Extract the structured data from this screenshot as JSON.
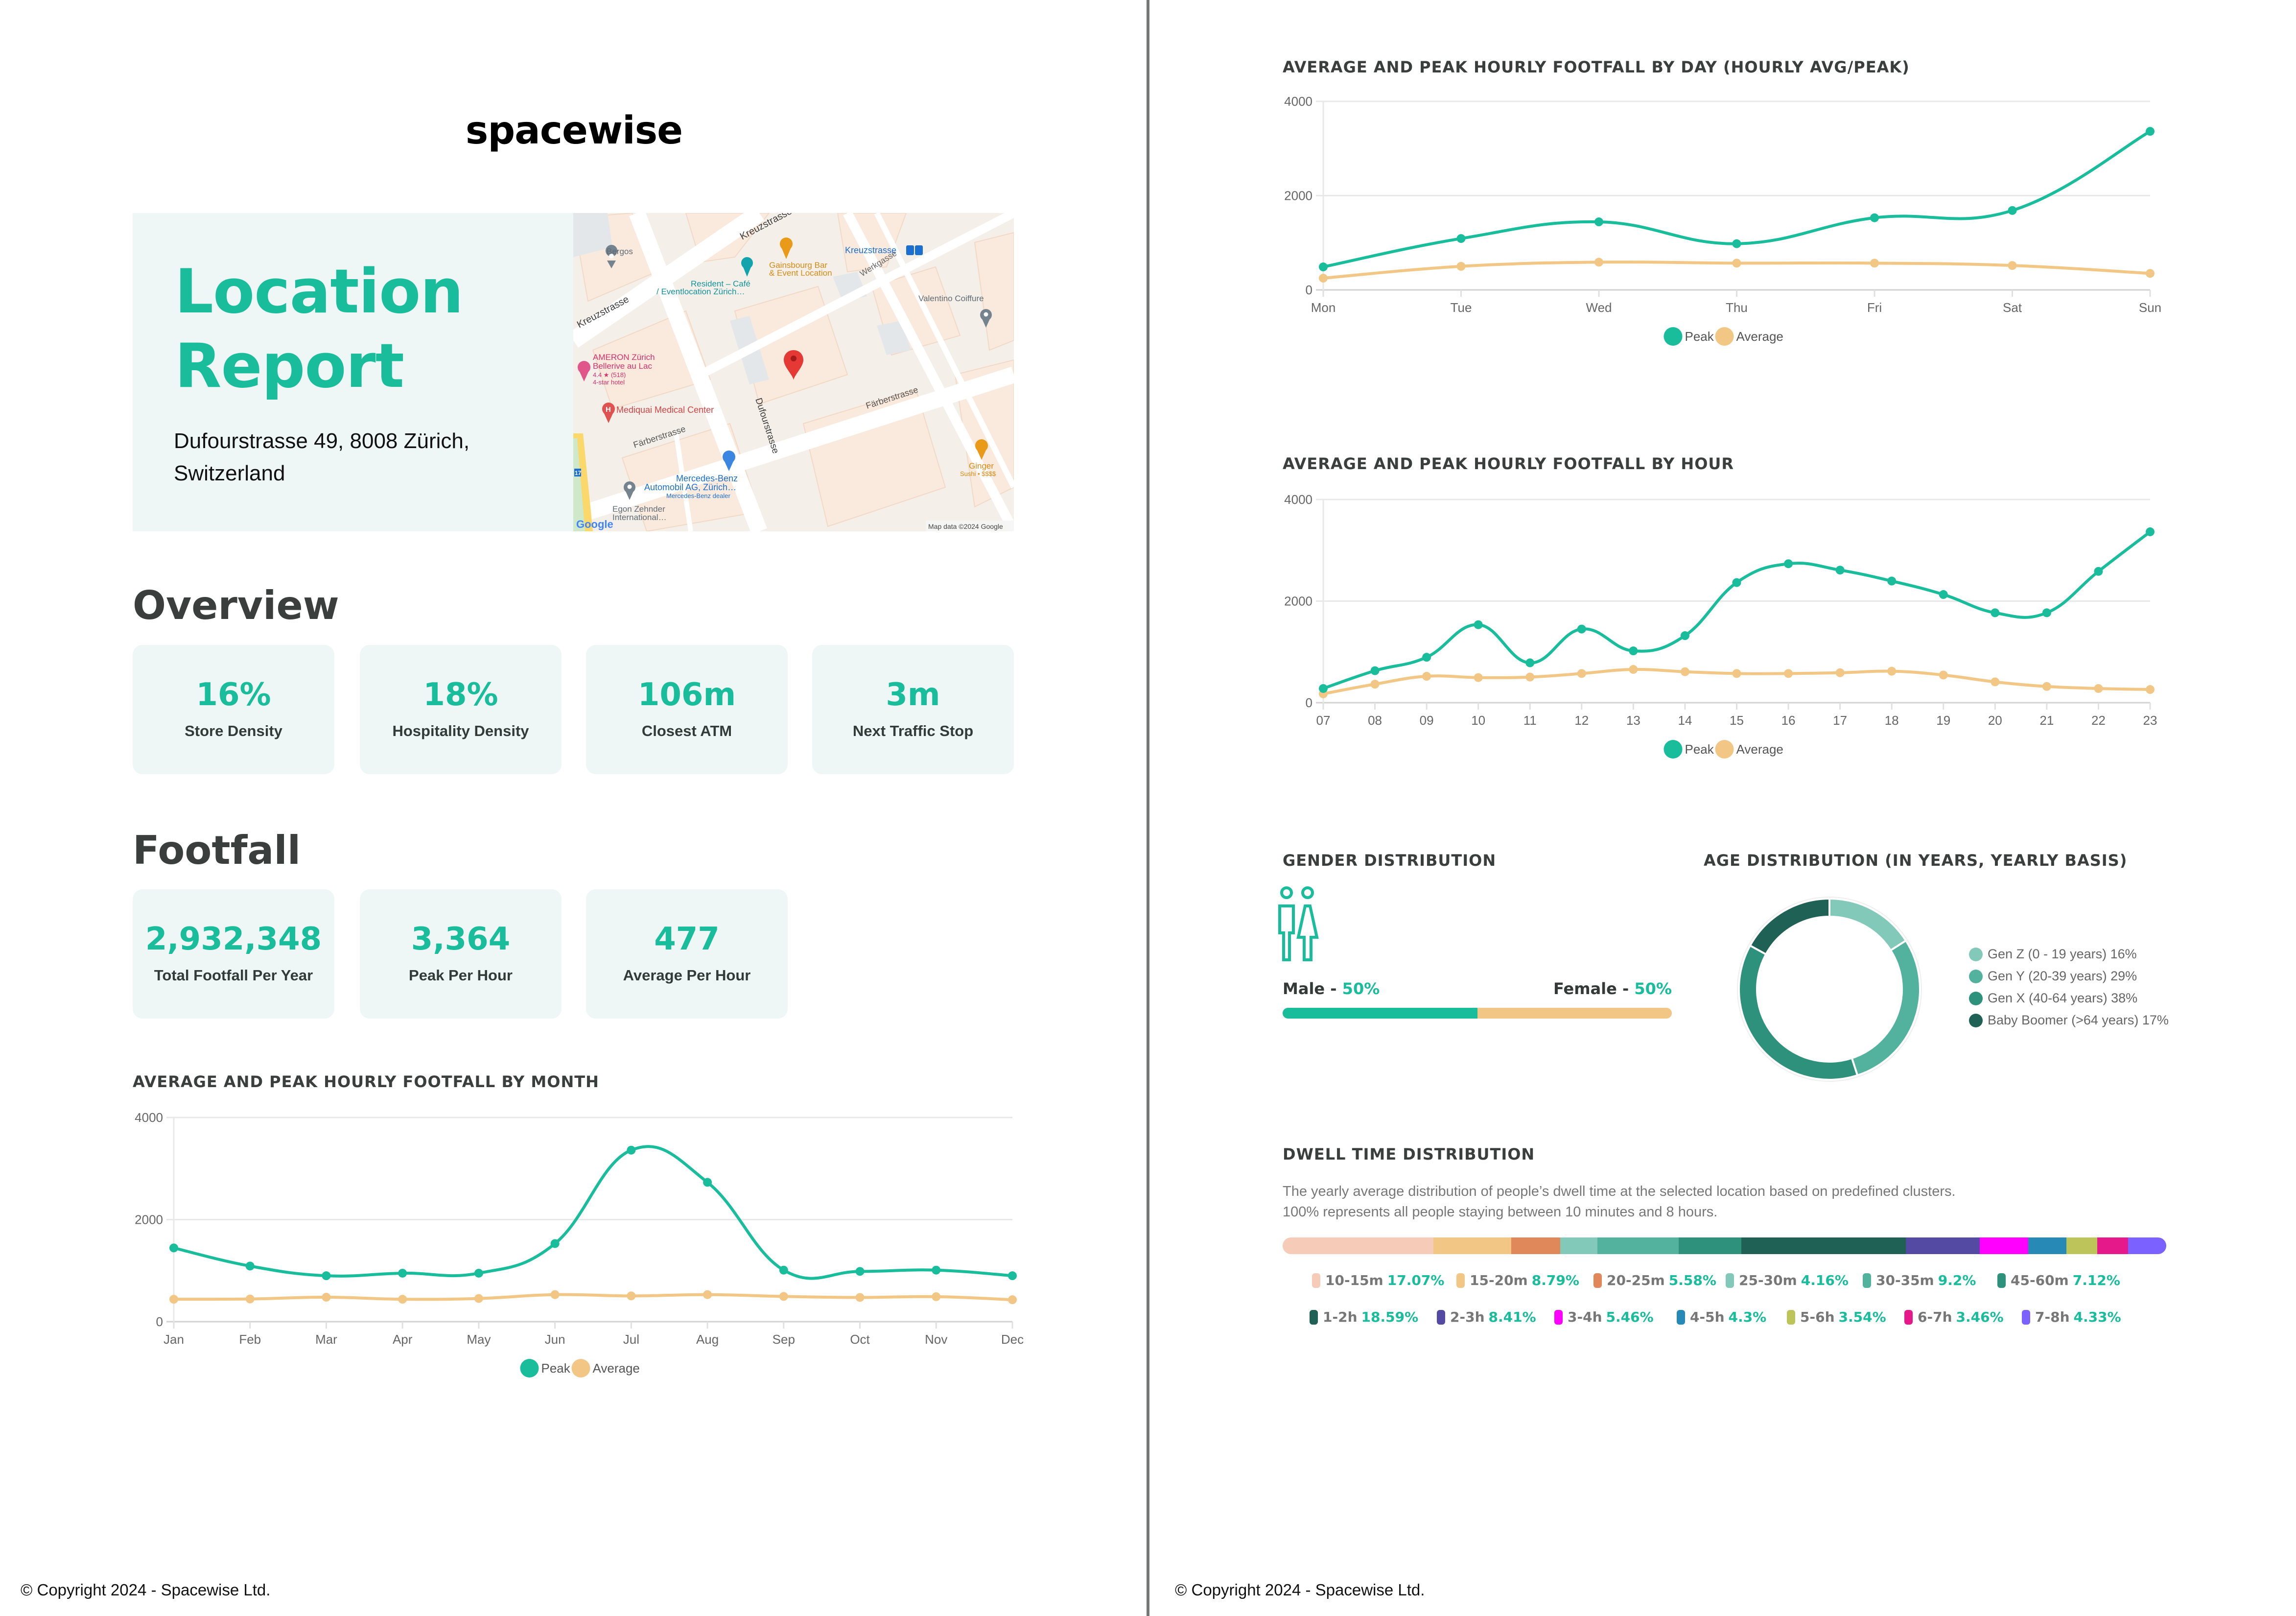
{
  "colors": {
    "accent": "#19bc9b",
    "average": "#f2c785",
    "card_bg": "#eef7f5",
    "grid": "#e6e6e6",
    "axis": "#cfcfcf",
    "divider": "#767878"
  },
  "brand": {
    "logo": "spacewise"
  },
  "hero": {
    "title_line1": "Location",
    "title_line2": "Report",
    "address_line1": "Dufourstrasse 49, 8008 Zürich,",
    "address_line2": "Switzerland"
  },
  "map": {
    "pin_icon": "location-pin-icon",
    "streets": [
      "Kreuzstrasse",
      "Kreuzstrasse",
      "Werkgasse",
      "Dufourstrasse",
      "Färberstrasse",
      "Färberstrasse"
    ],
    "places": [
      {
        "name": "Bergos",
        "color": "#5f6b75"
      },
      {
        "name": "Resident – Café",
        "sub": "/ Eventlocation Zürich…",
        "color": "#12939b"
      },
      {
        "name": "Gainsbourg Bar",
        "sub": "& Event Location",
        "color": "#d98a12"
      },
      {
        "name": "Kreuzstrasse",
        "color": "#1a6fd1"
      },
      {
        "name": "Valentino Coiffure",
        "color": "#5f6b75"
      },
      {
        "name": "AMERON Zürich",
        "sub": "Bellerive au Lac",
        "rating": "4.4 ★ (518)",
        "type": "4-star hotel",
        "color": "#d6306d"
      },
      {
        "name": "Mediquai Medical Center",
        "color": "#d84343"
      },
      {
        "name": "Mercedes-Benz",
        "sub": "Automobil AG, Zürich…",
        "type": "Mercedes-Benz dealer",
        "color": "#1a6fd1"
      },
      {
        "name": "Egon Zehnder",
        "sub": "International…",
        "color": "#5f6b75"
      },
      {
        "name": "Ginger",
        "type": "Sushi • $$$$",
        "color": "#d98a12"
      }
    ],
    "route_badge": "17",
    "google_logo": "Google",
    "attribution": "Map data ©2024 Google"
  },
  "overview": {
    "heading": "Overview",
    "cards": [
      {
        "value": "16%",
        "label": "Store Density"
      },
      {
        "value": "18%",
        "label": "Hospitality Density"
      },
      {
        "value": "106m",
        "label": "Closest ATM"
      },
      {
        "value": "3m",
        "label": "Next Traffic Stop"
      }
    ]
  },
  "footfall": {
    "heading": "Footfall",
    "cards": [
      {
        "value": "2,932,348",
        "label": "Total Footfall Per Year"
      },
      {
        "value": "3,364",
        "label": "Peak Per Hour"
      },
      {
        "value": "477",
        "label": "Average Per Hour"
      }
    ]
  },
  "chart_data": [
    {
      "id": "month",
      "type": "line",
      "title": "AVERAGE AND PEAK HOURLY FOOTFALL BY MONTH",
      "xlabel": "",
      "ylabel": "",
      "categories": [
        "Jan",
        "Feb",
        "Mar",
        "Apr",
        "May",
        "Jun",
        "Jul",
        "Aug",
        "Sep",
        "Oct",
        "Nov",
        "Dec"
      ],
      "yticks": [
        0,
        2000,
        4000
      ],
      "ylim": [
        0,
        4000
      ],
      "grid": true,
      "legend": "bottom-center",
      "series": [
        {
          "name": "Peak",
          "color": "#19bc9b",
          "values": [
            1445,
            1090,
            900,
            950,
            950,
            1530,
            3360,
            2730,
            1010,
            985,
            1010,
            900
          ]
        },
        {
          "name": "Average",
          "color": "#f2c785",
          "values": [
            440,
            445,
            480,
            440,
            455,
            530,
            505,
            530,
            495,
            475,
            490,
            430
          ]
        }
      ]
    },
    {
      "id": "day",
      "type": "line",
      "title": "AVERAGE AND PEAK HOURLY FOOTFALL BY DAY (HOURLY AVG/PEAK)",
      "xlabel": "",
      "ylabel": "",
      "categories": [
        "Mon",
        "Tue",
        "Wed",
        "Thu",
        "Fri",
        "Sat",
        "Sun"
      ],
      "yticks": [
        0,
        2000,
        4000
      ],
      "ylim": [
        0,
        4000
      ],
      "grid": true,
      "legend": "bottom-center",
      "series": [
        {
          "name": "Peak",
          "color": "#19bc9b",
          "values": [
            488,
            1090,
            1444,
            980,
            1530,
            1685,
            3364
          ]
        },
        {
          "name": "Average",
          "color": "#f2c785",
          "values": [
            249,
            500,
            588,
            568,
            568,
            518,
            350
          ]
        }
      ]
    },
    {
      "id": "hour",
      "type": "line",
      "title": "AVERAGE AND PEAK HOURLY FOOTFALL BY HOUR",
      "xlabel": "",
      "ylabel": "",
      "categories": [
        "07",
        "08",
        "09",
        "10",
        "11",
        "12",
        "13",
        "14",
        "15",
        "16",
        "17",
        "18",
        "19",
        "20",
        "21",
        "22",
        "23"
      ],
      "yticks": [
        0,
        2000,
        4000
      ],
      "ylim": [
        0,
        4000
      ],
      "grid": true,
      "legend": "bottom-center",
      "series": [
        {
          "name": "Peak",
          "color": "#19bc9b",
          "values": [
            280,
            630,
            895,
            1535,
            785,
            1450,
            1020,
            1320,
            2365,
            2735,
            2610,
            2395,
            2130,
            1770,
            1770,
            2585,
            3364
          ]
        },
        {
          "name": "Average",
          "color": "#f2c785",
          "values": [
            175,
            365,
            520,
            495,
            505,
            575,
            655,
            610,
            575,
            575,
            590,
            620,
            545,
            410,
            320,
            280,
            260
          ]
        }
      ]
    },
    {
      "id": "age",
      "type": "pie",
      "title": "AGE DISTRIBUTION (IN YEARS, YEARLY BASIS)",
      "legend": "right",
      "slices": [
        {
          "label": "Gen Z (0 - 19 years) 16%",
          "value": 16,
          "color": "#82c9ba"
        },
        {
          "label": "Gen Y (20-39 years) 29%",
          "value": 29,
          "color": "#52b29e"
        },
        {
          "label": "Gen X (40-64 years) 38%",
          "value": 38,
          "color": "#2e917c"
        },
        {
          "label": "Baby Boomer (>64 years) 17%",
          "value": 17,
          "color": "#1f6154"
        }
      ]
    }
  ],
  "gender": {
    "title": "GENDER DISTRIBUTION",
    "icon": "male-female-icon",
    "male_label": "Male - ",
    "male_pct": "50%",
    "female_label": "Female - ",
    "female_pct": "50%",
    "male_share": 0.5,
    "female_share": 0.5,
    "male_color": "#19bc9b",
    "female_color": "#f2c785"
  },
  "dwell": {
    "title": "DWELL TIME DISTRIBUTION",
    "desc_line1": "The yearly average distribution of people’s dwell time at the selected location based on predefined clusters.",
    "desc_line2": "100% represents all people staying between 10 minutes and 8 hours.",
    "segments": [
      {
        "label": "10-15m",
        "pct": "17.07%",
        "value": 17.07,
        "color": "#f6cbb7"
      },
      {
        "label": "15-20m",
        "pct": "8.79%",
        "value": 8.79,
        "color": "#f2c785"
      },
      {
        "label": "20-25m",
        "pct": "5.58%",
        "value": 5.58,
        "color": "#e0885a"
      },
      {
        "label": "25-30m",
        "pct": "4.16%",
        "value": 4.16,
        "color": "#82c9ba"
      },
      {
        "label": "30-35m",
        "pct": "9.2%",
        "value": 9.2,
        "color": "#52b29e"
      },
      {
        "label": "45-60m",
        "pct": "7.12%",
        "value": 7.12,
        "color": "#2e917c"
      },
      {
        "label": "1-2h",
        "pct": "18.59%",
        "value": 18.59,
        "color": "#1f6154"
      },
      {
        "label": "2-3h",
        "pct": "8.41%",
        "value": 8.41,
        "color": "#5449a3"
      },
      {
        "label": "3-4h",
        "pct": "5.46%",
        "value": 5.46,
        "color": "#ff00ff"
      },
      {
        "label": "4-5h",
        "pct": "4.3%",
        "value": 4.3,
        "color": "#2789b5"
      },
      {
        "label": "5-6h",
        "pct": "3.54%",
        "value": 3.54,
        "color": "#bcc45a"
      },
      {
        "label": "6-7h",
        "pct": "3.46%",
        "value": 3.46,
        "color": "#e6198a"
      },
      {
        "label": "7-8h",
        "pct": "4.33%",
        "value": 4.33,
        "color": "#7b61ff"
      }
    ]
  },
  "footer": {
    "left": "© Copyright 2024 - Spacewise Ltd.",
    "right": "© Copyright 2024 - Spacewise Ltd."
  }
}
